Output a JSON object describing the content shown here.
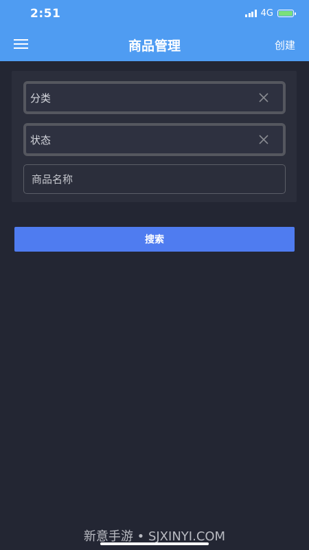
{
  "status_bar": {
    "time": "2:51",
    "network": "4G"
  },
  "header": {
    "title": "商品管理",
    "create_label": "创建"
  },
  "filters": {
    "category_label": "分类",
    "status_label": "状态",
    "name_placeholder": "商品名称"
  },
  "search_label": "搜索",
  "watermark": "新意手游 • SJXINYI.COM",
  "icons": {
    "menu": "hamburger-menu-icon",
    "clear": "close-icon",
    "signal": "signal-icon",
    "battery": "battery-charging-icon"
  },
  "colors": {
    "header_bg": "#4f9cf2",
    "page_bg": "#232633",
    "card_bg": "#2b2e3b",
    "button_bg": "#4f7cf0",
    "battery": "#7be07b"
  }
}
